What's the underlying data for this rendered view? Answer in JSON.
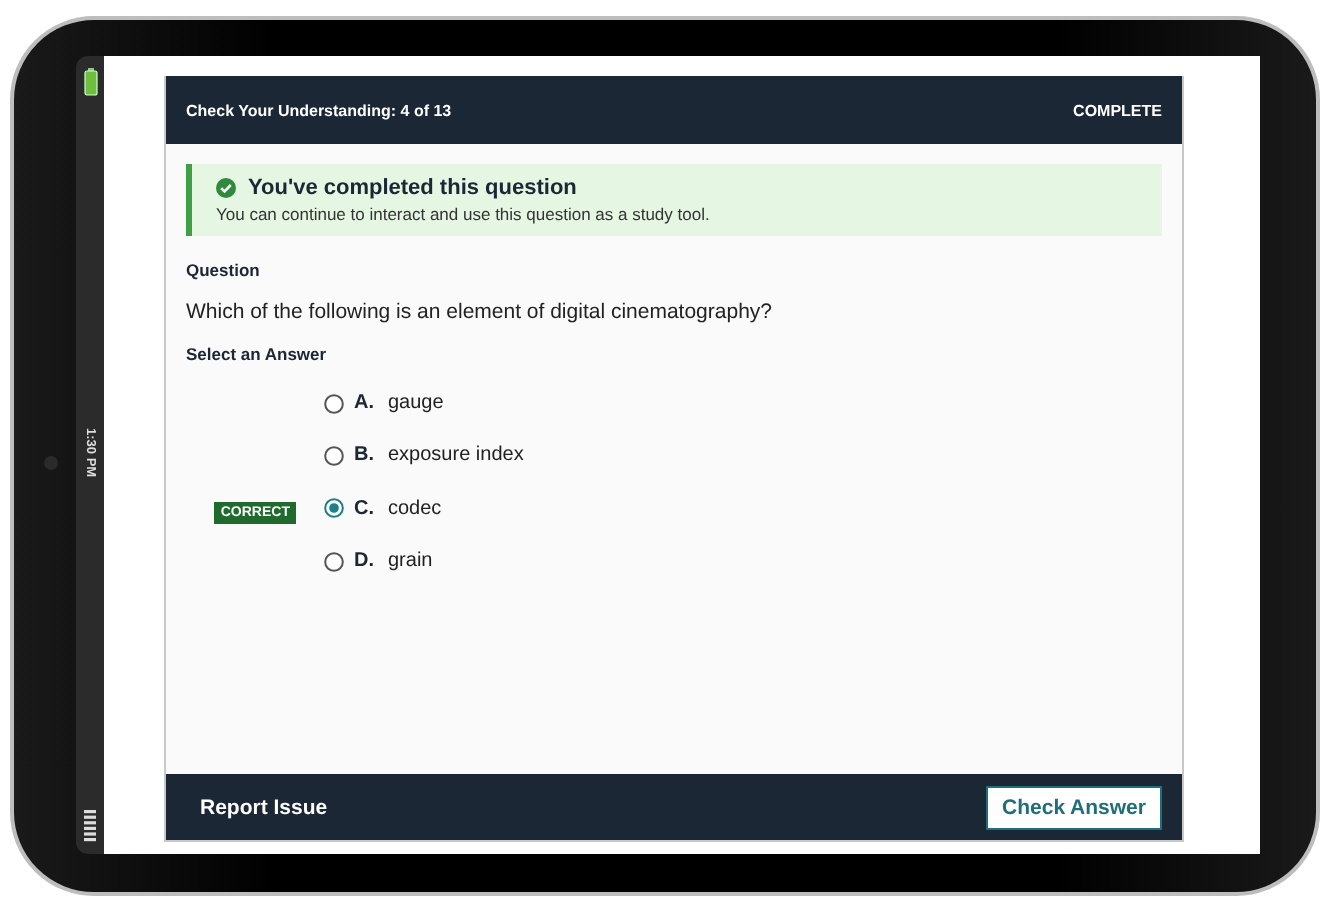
{
  "device": {
    "status_time": "1:30 PM"
  },
  "header": {
    "title": "Check Your Understanding: 4 of 13",
    "status": "COMPLETE"
  },
  "notice": {
    "title": "You've completed this question",
    "message": "You can continue to interact and use this question as a study tool."
  },
  "question": {
    "label": "Question",
    "text": "Which of the following is an element of digital cinematography?"
  },
  "answers_label": "Select an Answer",
  "answers": [
    {
      "letter": "A.",
      "text": "gauge",
      "selected": false
    },
    {
      "letter": "B.",
      "text": "exposure index",
      "selected": false
    },
    {
      "letter": "C.",
      "text": "codec",
      "selected": true,
      "badge": "CORRECT"
    },
    {
      "letter": "D.",
      "text": "grain",
      "selected": false
    }
  ],
  "footer": {
    "link": "Report Issue",
    "button": "Check Answer"
  }
}
